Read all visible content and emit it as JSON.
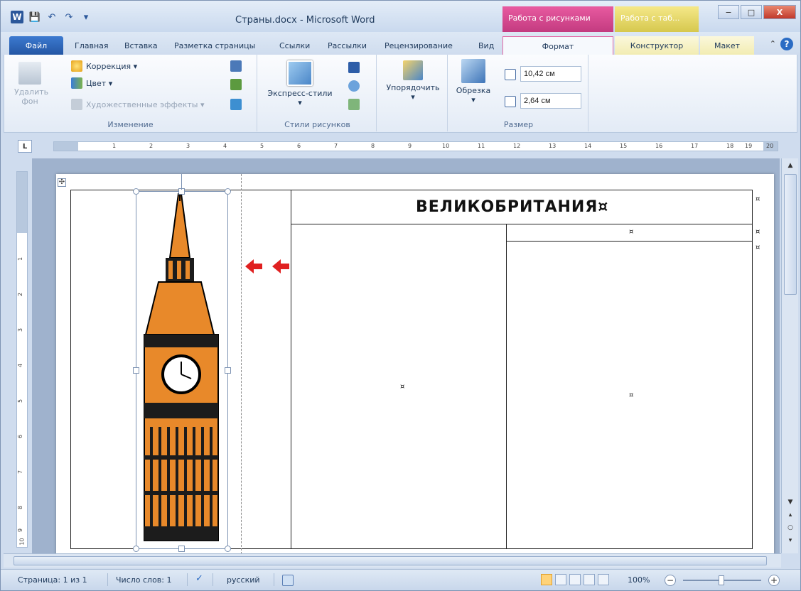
{
  "window": {
    "title": "Страны.docx - Microsoft Word",
    "context_pictures": "Работа с рисунками",
    "context_tables": "Работа с таб...",
    "minimize": "−",
    "maximize": "□",
    "close": "X"
  },
  "qat": {
    "app_icon": "W",
    "save": "💾",
    "undo": "↶",
    "redo": "↷",
    "customize": "▾"
  },
  "tabs": {
    "file": "Файл",
    "home": "Главная",
    "insert": "Вставка",
    "layout": "Разметка страницы",
    "refs": "Ссылки",
    "mailings": "Рассылки",
    "review": "Рецензирование",
    "view": "Вид",
    "format": "Формат",
    "design": "Конструктор",
    "layout2": "Макет",
    "collapse": "⌃",
    "help": "?"
  },
  "ribbon": {
    "adjust": {
      "remove_bg": "Удалить фон",
      "correction": "Коррекция ▾",
      "color": "Цвет ▾",
      "artistic": "Художественные эффекты ▾",
      "label": "Изменение"
    },
    "styles": {
      "express": "Экспресс-стили",
      "express_arrow": "▾",
      "label": "Стили рисунков"
    },
    "arrange": {
      "arrange": "Упорядочить",
      "arrange_arrow": "▾"
    },
    "size": {
      "crop": "Обрезка",
      "crop_arrow": "▾",
      "height": "10,42 см",
      "width": "2,64 см",
      "label": "Размер"
    }
  },
  "ruler": {
    "button": "L",
    "ticks": [
      "1",
      "2",
      "3",
      "4",
      "5",
      "6",
      "7",
      "8",
      "9",
      "10",
      "11",
      "12",
      "13",
      "14",
      "15",
      "16",
      "17",
      "18",
      "19",
      "20"
    ]
  },
  "vruler": {
    "ticks": [
      "1",
      "2",
      "3",
      "4",
      "5",
      "6",
      "7",
      "8",
      "9",
      "10"
    ]
  },
  "document": {
    "heading": "ВЕЛИКОБРИТАНИЯ¤",
    "cell_mark": "¤",
    "move_handle": "✣"
  },
  "status": {
    "page": "Страница: 1 из 1",
    "words": "Число слов: 1",
    "lang": "русский",
    "zoom": "100%",
    "zoom_out": "−",
    "zoom_in": "+"
  }
}
